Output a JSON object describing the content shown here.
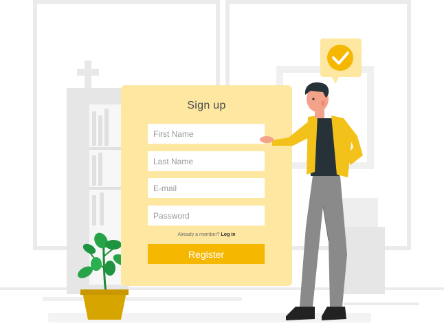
{
  "form": {
    "title": "Sign up",
    "fields": [
      {
        "placeholder": "First Name",
        "value": ""
      },
      {
        "placeholder": "Last Name",
        "value": ""
      },
      {
        "placeholder": "E-mail",
        "value": ""
      },
      {
        "placeholder": "Password",
        "value": ""
      }
    ],
    "member_prompt": "Already a member?",
    "login_label": "Log in",
    "register_label": "Register"
  },
  "colors": {
    "card_background": "#fde7a1",
    "accent": "#f5b700",
    "jacket": "#f2c21a",
    "checkmark_badge": "#f5b700"
  },
  "icons": [
    "checkmark-icon",
    "plant-illustration",
    "person-illustration"
  ]
}
